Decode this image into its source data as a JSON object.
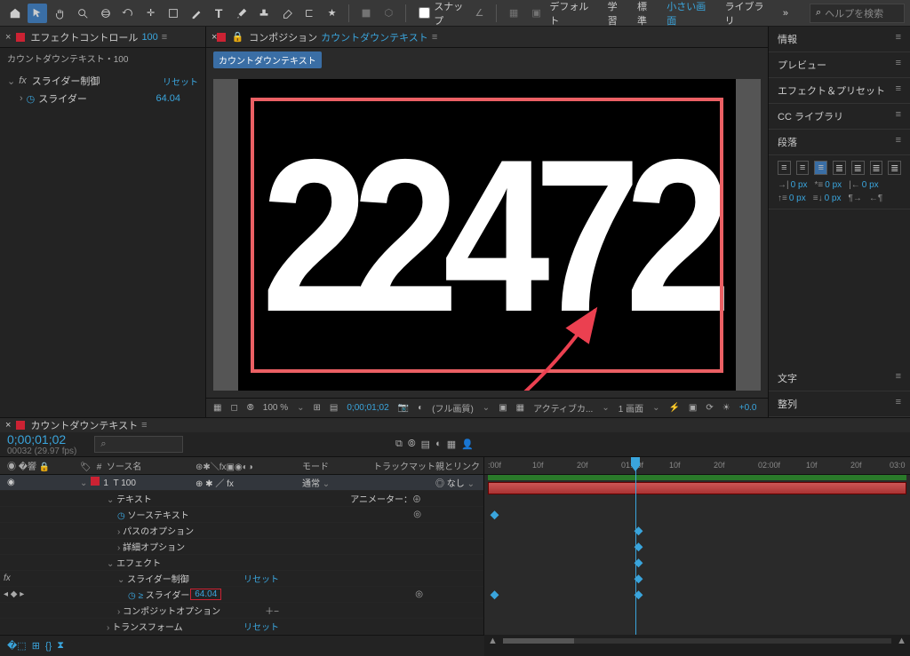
{
  "toolbar": {
    "snap_label": "スナップ",
    "workspaces": [
      "デフォルト",
      "学習",
      "標準",
      "小さい画面",
      "ライブラリ"
    ],
    "active_ws": 3,
    "search_placeholder": "ヘルプを検索"
  },
  "effect_controls": {
    "tab_prefix": "エフェクトコントロール",
    "tab_link": "100",
    "header": "カウントダウンテキスト・100",
    "effect_name": "スライダー制御",
    "reset": "リセット",
    "prop_name": "スライダー",
    "prop_value": "64.04"
  },
  "viewer": {
    "tab_prefix": "コンポジション",
    "tab_link": "カウントダウンテキスト",
    "comp_tag": "カウントダウンテキスト",
    "display_number": "22472",
    "zoom": "100 %",
    "timecode": "0;00;01;02",
    "quality": "(フル画質)",
    "camera": "アクティブカ...",
    "views": "1 画面",
    "exposure": "+0.0"
  },
  "right": {
    "sections": [
      "情報",
      "プレビュー",
      "エフェクト＆プリセット",
      "CC ライブラリ"
    ],
    "paragraph_title": "段落",
    "paragraph_px": "0 px",
    "sections2": [
      "文字",
      "整列"
    ]
  },
  "timeline": {
    "tab": "カウントダウンテキスト",
    "timecode": "0;00;01;02",
    "fps": "00032 (29.97 fps)",
    "columns": {
      "idx": "#",
      "src": "ソース名",
      "switch": "",
      "mode": "モード",
      "trk": "トラックマット",
      "parent": "親とリンク"
    },
    "ruler": [
      ":00f",
      "10f",
      "20f",
      "01:00f",
      "10f",
      "20f",
      "02:00f",
      "10f",
      "20f",
      "03:0"
    ],
    "layer": {
      "num": "1",
      "name": "T   100",
      "mode": "通常",
      "parent": "なし",
      "animator": "アニメーター："
    },
    "rows": [
      "テキスト",
      "ソーステキスト",
      "パスのオプション",
      "詳細オプション",
      "エフェクト",
      "スライダー制御",
      "スライダー",
      "コンポジットオプション",
      "トランスフォーム"
    ],
    "reset": "リセット",
    "slider_val": "64.04"
  }
}
